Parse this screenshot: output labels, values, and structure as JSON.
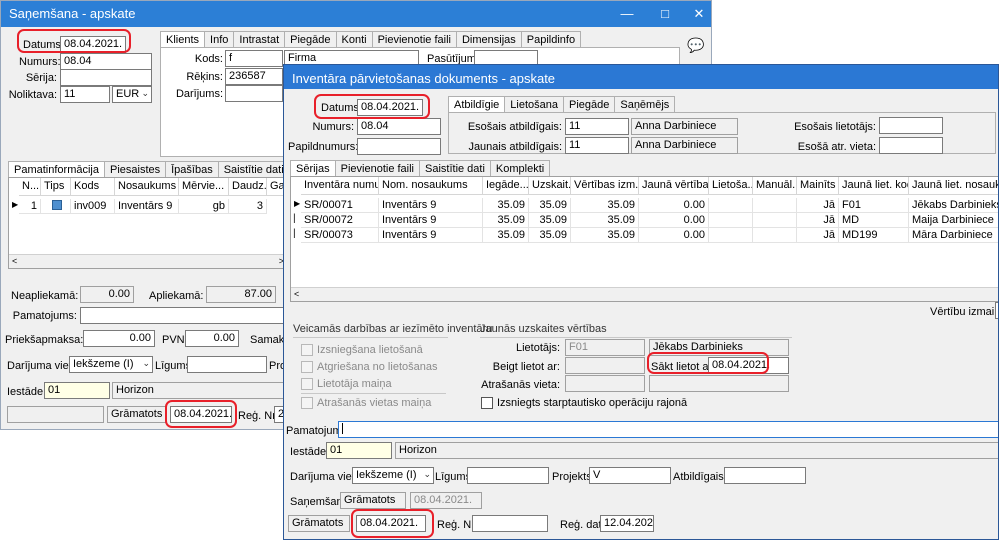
{
  "back": {
    "title": "Saņemšana - apskate",
    "datums_label": "Datums:",
    "datums": "08.04.2021.",
    "numurs_label": "Numurs:",
    "numurs": "08.04",
    "serija_label": "Sērija:",
    "noliktava_label": "Noliktava:",
    "noliktava": "11",
    "valuta": "EUR",
    "tabs": [
      "Klients",
      "Info",
      "Intrastat",
      "Piegāde",
      "Konti",
      "Pievienotie faili",
      "Dimensijas",
      "Papildinfo"
    ],
    "kods_label": "Kods:",
    "kods": "f",
    "firma": "Firma",
    "pasutijums_label": "Pasūtījums:",
    "rekins_label": "Rēķins:",
    "rekins": "236587",
    "darijums_label": "Darījums:",
    "lower_tabs": [
      "Pamatinformācija",
      "Piesaistes",
      "Īpašības",
      "Saistītie dati"
    ],
    "grid_headers": [
      "N...",
      "Tips",
      "Kods",
      "Nosaukums",
      "Mērvie...",
      "Daudz...",
      "Ga"
    ],
    "grid_row": [
      "1",
      "inv009",
      "Inventārs 9",
      "gb",
      "3"
    ],
    "neapliekama_label": "Neapliekamā:",
    "neapliekama": "0.00",
    "apliekama_label": "Apliekamā:",
    "apliekama": "87.00",
    "pamatojums_label": "Pamatojums:",
    "priekssamaksa_label": "Priekšapmaksa:",
    "priekssamaksa": "0.00",
    "pvn_label": "PVN:",
    "pvn": "0.00",
    "samaksa_label": "Samaksa",
    "darijuma_vieta_label": "Darījuma vieta:",
    "darijuma_vieta": "Iekšzeme (I)",
    "ligums_label": "Līgums:",
    "proj_label": "Proj",
    "iestade_label": "Iestāde:",
    "iestade": "01",
    "iestade_name": "Horizon",
    "gramatots_label": "Grāmatots",
    "gramatots_date": "08.04.2021.",
    "reg_nr_label": "Reģ. Nr.",
    "reg_nr": "2"
  },
  "front": {
    "title": "Inventāra pārvietošanas dokuments - apskate",
    "datums_label": "Datums:",
    "datums": "08.04.2021.",
    "numurs_label": "Numurs:",
    "numurs": "08.04",
    "papildnumurs_label": "Papildnumurs:",
    "top_tabs": [
      "Atbildīgie",
      "Lietošana",
      "Piegāde",
      "Saņēmējs"
    ],
    "esosais_atb_label": "Esošais atbildīgais:",
    "esosais_atb_code": "11",
    "esosais_atb_name": "Anna Darbiniece",
    "jaunais_atb_label": "Jaunais atbildīgais:",
    "jaunais_atb_code": "11",
    "jaunais_atb_name": "Anna Darbiniece",
    "esosais_liet_label": "Esošais lietotājs:",
    "esosa_vieta_label": "Esošā atr. vieta:",
    "mid_tabs": [
      "Sērijas",
      "Pievienotie faili",
      "Saistītie dati",
      "Komplekti"
    ],
    "grid_headers": [
      "Inventāra numurs",
      "Nom. nosaukums",
      "Iegāde...",
      "Uzskait...",
      "Vērtības izm...",
      "Jaunā vērtība, ...",
      "Lietoša...",
      "Manuāl...",
      "Mainīts ...",
      "Jaunā liet. kods",
      "Jaunā liet. nosaukums"
    ],
    "rows": [
      [
        "SR/00071",
        "Inventārs 9",
        "35.09",
        "35.09",
        "35.09",
        "0.00",
        "",
        "",
        "Jā",
        "F01",
        "Jēkabs Darbinieks"
      ],
      [
        "SR/00072",
        "Inventārs 9",
        "35.09",
        "35.09",
        "35.09",
        "0.00",
        "",
        "",
        "Jā",
        "MD",
        "Maija Darbiniece"
      ],
      [
        "SR/00073",
        "Inventārs 9",
        "35.09",
        "35.09",
        "35.09",
        "0.00",
        "",
        "",
        "Jā",
        "MD199",
        "Māra Darbiniece"
      ]
    ],
    "vertibu_izmaina_label": "Vērtību izmaiņa:",
    "group1_title": "Veicamās darbības ar iezīmēto inventāru",
    "group1_items": [
      "Izsniegšana lietošanā",
      "Atgriešana no lietošanas",
      "Lietotāja maiņa",
      "Atrašanās vietas maiņa"
    ],
    "group2_title": "Jaunās uzskaites vērtības",
    "lietotajs_label": "Lietotājs:",
    "lietotajs_code": "F01",
    "lietotajs_name": "Jēkabs Darbinieks",
    "beigt_label": "Beigt lietot ar:",
    "sakt_label": "Sākt lietot ar:",
    "sakt_date": "08.04.2021.",
    "atrasanas_label": "Atrašanās vieta:",
    "izsniegts_label": "Izsniegts starptautisko operāciju rajonā",
    "pamatojums_label": "Pamatojums:",
    "iestade_label": "Iestāde:",
    "iestade": "01",
    "iestade_name": "Horizon",
    "darijuma_vieta_label": "Darījuma vieta:",
    "darijuma_vieta": "Iekšzeme (I)",
    "ligums_label": "Līgums:",
    "projekts_label": "Projekts:",
    "projekts": "V",
    "atbildigais_label": "Atbildīgais:",
    "sanemsana_label": "Saņemšana:",
    "sanemsana_status": "Grāmatots",
    "sanemsana_date": "08.04.2021.",
    "gramatots_label": "Grāmatots",
    "gramatots_date": "08.04.2021.",
    "reg_nr_label": "Reģ. Nr.",
    "reg_dat_label": "Reģ. dat.",
    "reg_dat": "12.04.2021."
  },
  "colors": {
    "titlebar": "#2b78d4",
    "highlight": "#e8202a"
  }
}
